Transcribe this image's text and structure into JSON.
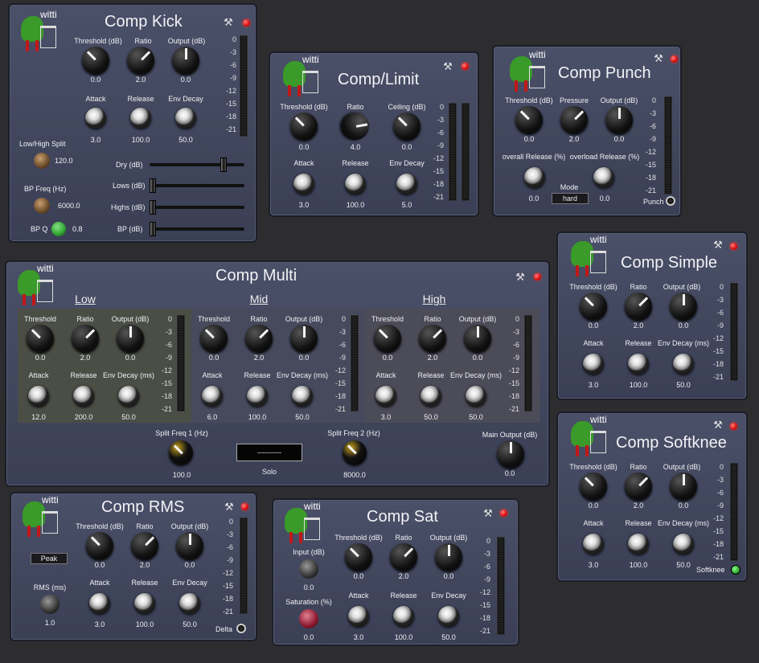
{
  "logo_text": "witti",
  "kick": {
    "title": "Comp Kick",
    "threshold": "Threshold (dB)",
    "ratio": "Ratio",
    "output": "Output (dB)",
    "v_threshold": "0.0",
    "v_ratio": "2.0",
    "v_output": "0.0",
    "attack": "Attack",
    "release": "Release",
    "envdecay": "Env Decay",
    "v_attack": "3.0",
    "v_release": "100.0",
    "v_envdecay": "50.0",
    "split": "Low/High Split",
    "v_split": "120.0",
    "bpfreq": "BP Freq (Hz)",
    "v_bpfreq": "6000.0",
    "bpq": "BP Q",
    "v_bpq": "0.8",
    "dry": "Dry (dB)",
    "lows": "Lows (dB)",
    "highs": "Highs (dB)",
    "bp": "BP (dB)"
  },
  "scale": [
    "0",
    "-3",
    "-6",
    "-9",
    "-12",
    "-15",
    "-18",
    "-21"
  ],
  "limit": {
    "title": "Comp/Limit",
    "threshold": "Threshold (dB)",
    "ratio": "Ratio",
    "ceiling": "Ceiling (dB)",
    "v_threshold": "0.0",
    "v_ratio": "4.0",
    "v_ceiling": "0.0",
    "attack": "Attack",
    "release": "Release",
    "envdecay": "Env Decay",
    "v_attack": "3.0",
    "v_release": "100.0",
    "v_envdecay": "5.0"
  },
  "punch": {
    "title": "Comp Punch",
    "threshold": "Threshold (dB)",
    "pressure": "Pressure",
    "output": "Output (dB)",
    "v_threshold": "0.0",
    "v_pressure": "2.0",
    "v_output": "0.0",
    "orel": "overall Release (%)",
    "olrel": "overload Release (%)",
    "v_orel": "0.0",
    "v_olrel": "0.0",
    "mode": "Mode",
    "v_mode": "hard",
    "punch": "Punch"
  },
  "simple": {
    "title": "Comp Simple",
    "threshold": "Threshold (dB)",
    "ratio": "Ratio",
    "output": "Output (dB)",
    "v_threshold": "0.0",
    "v_ratio": "2.0",
    "v_output": "0.0",
    "attack": "Attack",
    "release": "Release",
    "envdecay": "Env Decay (ms)",
    "v_attack": "3.0",
    "v_release": "100.0",
    "v_envdecay": "50.0"
  },
  "multi": {
    "title": "Comp Multi",
    "low": "Low",
    "mid": "Mid",
    "high": "High",
    "threshold": "Threshold",
    "ratio": "Ratio",
    "output": "Output (dB)",
    "attack": "Attack",
    "release": "Release",
    "envdecay": "Env Decay (ms)",
    "l_thr": "0.0",
    "l_rat": "2.0",
    "l_out": "0.0",
    "l_att": "12.0",
    "l_rel": "200.0",
    "l_env": "50.0",
    "m_thr": "0.0",
    "m_rat": "2.0",
    "m_out": "0.0",
    "m_att": "6.0",
    "m_rel": "100.0",
    "m_env": "50.0",
    "h_thr": "0.0",
    "h_rat": "2.0",
    "h_out": "0.0",
    "h_att": "3.0",
    "h_rel": "50.0",
    "h_env": "50.0",
    "split1": "Split Freq 1 (Hz)",
    "v_split1": "100.0",
    "solo_val": "----------",
    "solo": "Solo",
    "split2": "Split Freq 2 (Hz)",
    "v_split2": "8000.0",
    "main": "Main Output (dB)",
    "v_main": "0.0"
  },
  "softknee": {
    "title": "Comp Softknee",
    "threshold": "Threshold (dB)",
    "ratio": "Ratio",
    "output": "Output (dB)",
    "v_threshold": "0.0",
    "v_ratio": "2.0",
    "v_output": "0.0",
    "attack": "Attack",
    "release": "Release",
    "envdecay": "Env Decay (ms)",
    "v_attack": "3.0",
    "v_release": "100.0",
    "v_envdecay": "50.0",
    "softknee": "Softknee"
  },
  "rms": {
    "title": "Comp RMS",
    "threshold": "Threshold (dB)",
    "ratio": "Ratio",
    "output": "Output (dB)",
    "v_threshold": "0.0",
    "v_ratio": "2.0",
    "v_output": "0.0",
    "peak": "Peak",
    "rmsms": "RMS (ms)",
    "v_rmsms": "1.0",
    "attack": "Attack",
    "release": "Release",
    "envdecay": "Env Decay",
    "v_attack": "3.0",
    "v_release": "100.0",
    "v_envdecay": "50.0",
    "delta": "Delta"
  },
  "sat": {
    "title": "Comp Sat",
    "input": "Input (dB)",
    "v_input": "0.0",
    "saturation": "Saturation (%)",
    "v_saturation": "0.0",
    "threshold": "Threshold (dB)",
    "ratio": "Ratio",
    "output": "Output (dB)",
    "v_threshold": "0.0",
    "v_ratio": "2.0",
    "v_output": "0.0",
    "attack": "Attack",
    "release": "Release",
    "envdecay": "Env Decay",
    "v_attack": "3.0",
    "v_release": "100.0",
    "v_envdecay": "50.0"
  }
}
